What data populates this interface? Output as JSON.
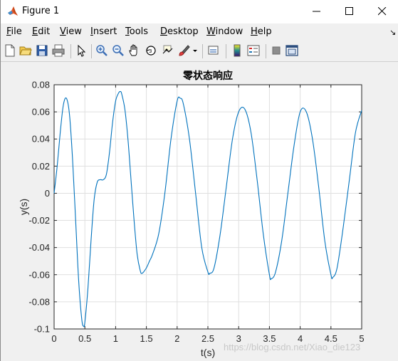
{
  "window": {
    "title": "Figure 1"
  },
  "menu": {
    "items": [
      {
        "key": "F",
        "rest": "ile"
      },
      {
        "key": "E",
        "rest": "dit"
      },
      {
        "key": "V",
        "rest": "iew"
      },
      {
        "key": "I",
        "rest": "nsert"
      },
      {
        "key": "T",
        "rest": "ools"
      },
      {
        "key": "D",
        "rest": "esktop"
      },
      {
        "key": "W",
        "rest": "indow"
      },
      {
        "key": "H",
        "rest": "elp"
      }
    ]
  },
  "toolbar": {
    "icons": [
      "new-figure-icon",
      "open-file-icon",
      "save-icon",
      "print-icon",
      "pointer-icon",
      "zoom-in-icon",
      "zoom-out-icon",
      "pan-hand-icon",
      "rotate-3d-icon",
      "data-cursor-icon",
      "brush-icon",
      "brush-dropdown-icon",
      "link-plot-icon",
      "colorbar-icon",
      "legend-icon",
      "hide-plot-tools-icon",
      "show-plot-tools-icon"
    ]
  },
  "watermark": "https://blog.csdn.net/Xiao_die123",
  "chart_data": {
    "type": "line",
    "title": "零状态响应",
    "xlabel": "t(s)",
    "ylabel": "y(s)",
    "xlim": [
      0,
      5
    ],
    "ylim": [
      -0.1,
      0.08
    ],
    "xticks": [
      "0",
      "0.5",
      "1",
      "1.5",
      "2",
      "2.5",
      "3",
      "3.5",
      "4",
      "4.5",
      "5"
    ],
    "yticks": [
      "0.08",
      "0.06",
      "0.04",
      "0.02",
      "0",
      "-0.02",
      "-0.04",
      "-0.06",
      "-0.08",
      "-0.1"
    ],
    "grid": true,
    "line_color": "#0072bd",
    "series": [
      {
        "x": [
          0,
          0.05,
          0.1,
          0.15,
          0.2,
          0.25,
          0.3,
          0.35,
          0.4,
          0.45,
          0.48,
          0.5,
          0.55,
          0.6,
          0.65,
          0.7,
          0.75,
          0.8,
          0.85,
          0.9,
          0.95,
          1.0,
          1.05,
          1.08,
          1.1,
          1.15,
          1.2,
          1.25,
          1.3,
          1.35,
          1.4,
          1.43,
          1.5,
          1.55,
          1.6,
          1.7,
          1.8,
          1.9,
          2.0,
          2.05,
          2.1,
          2.2,
          2.3,
          2.4,
          2.5,
          2.53,
          2.6,
          2.7,
          2.8,
          2.9,
          3.0,
          3.1,
          3.2,
          3.3,
          3.4,
          3.5,
          3.53,
          3.6,
          3.7,
          3.8,
          3.9,
          4.0,
          4.1,
          4.2,
          4.3,
          4.4,
          4.5,
          4.53,
          4.6,
          4.7,
          4.8,
          4.9,
          5.0
        ],
        "y": [
          0,
          0.02,
          0.045,
          0.065,
          0.07,
          0.058,
          0.025,
          -0.02,
          -0.065,
          -0.093,
          -0.098,
          -0.095,
          -0.07,
          -0.035,
          -0.005,
          0.008,
          0.01,
          0.01,
          0.014,
          0.03,
          0.052,
          0.068,
          0.074,
          0.075,
          0.073,
          0.062,
          0.04,
          0.01,
          -0.02,
          -0.045,
          -0.057,
          -0.059,
          -0.055,
          -0.05,
          -0.045,
          -0.03,
          0.0,
          0.04,
          0.068,
          0.07,
          0.066,
          0.04,
          0.0,
          -0.04,
          -0.058,
          -0.059,
          -0.055,
          -0.03,
          0.005,
          0.04,
          0.06,
          0.062,
          0.045,
          0.01,
          -0.03,
          -0.06,
          -0.063,
          -0.058,
          -0.035,
          0.0,
          0.035,
          0.06,
          0.06,
          0.04,
          0.005,
          -0.035,
          -0.06,
          -0.062,
          -0.055,
          -0.025,
          0.01,
          0.045,
          0.061
        ]
      }
    ]
  }
}
